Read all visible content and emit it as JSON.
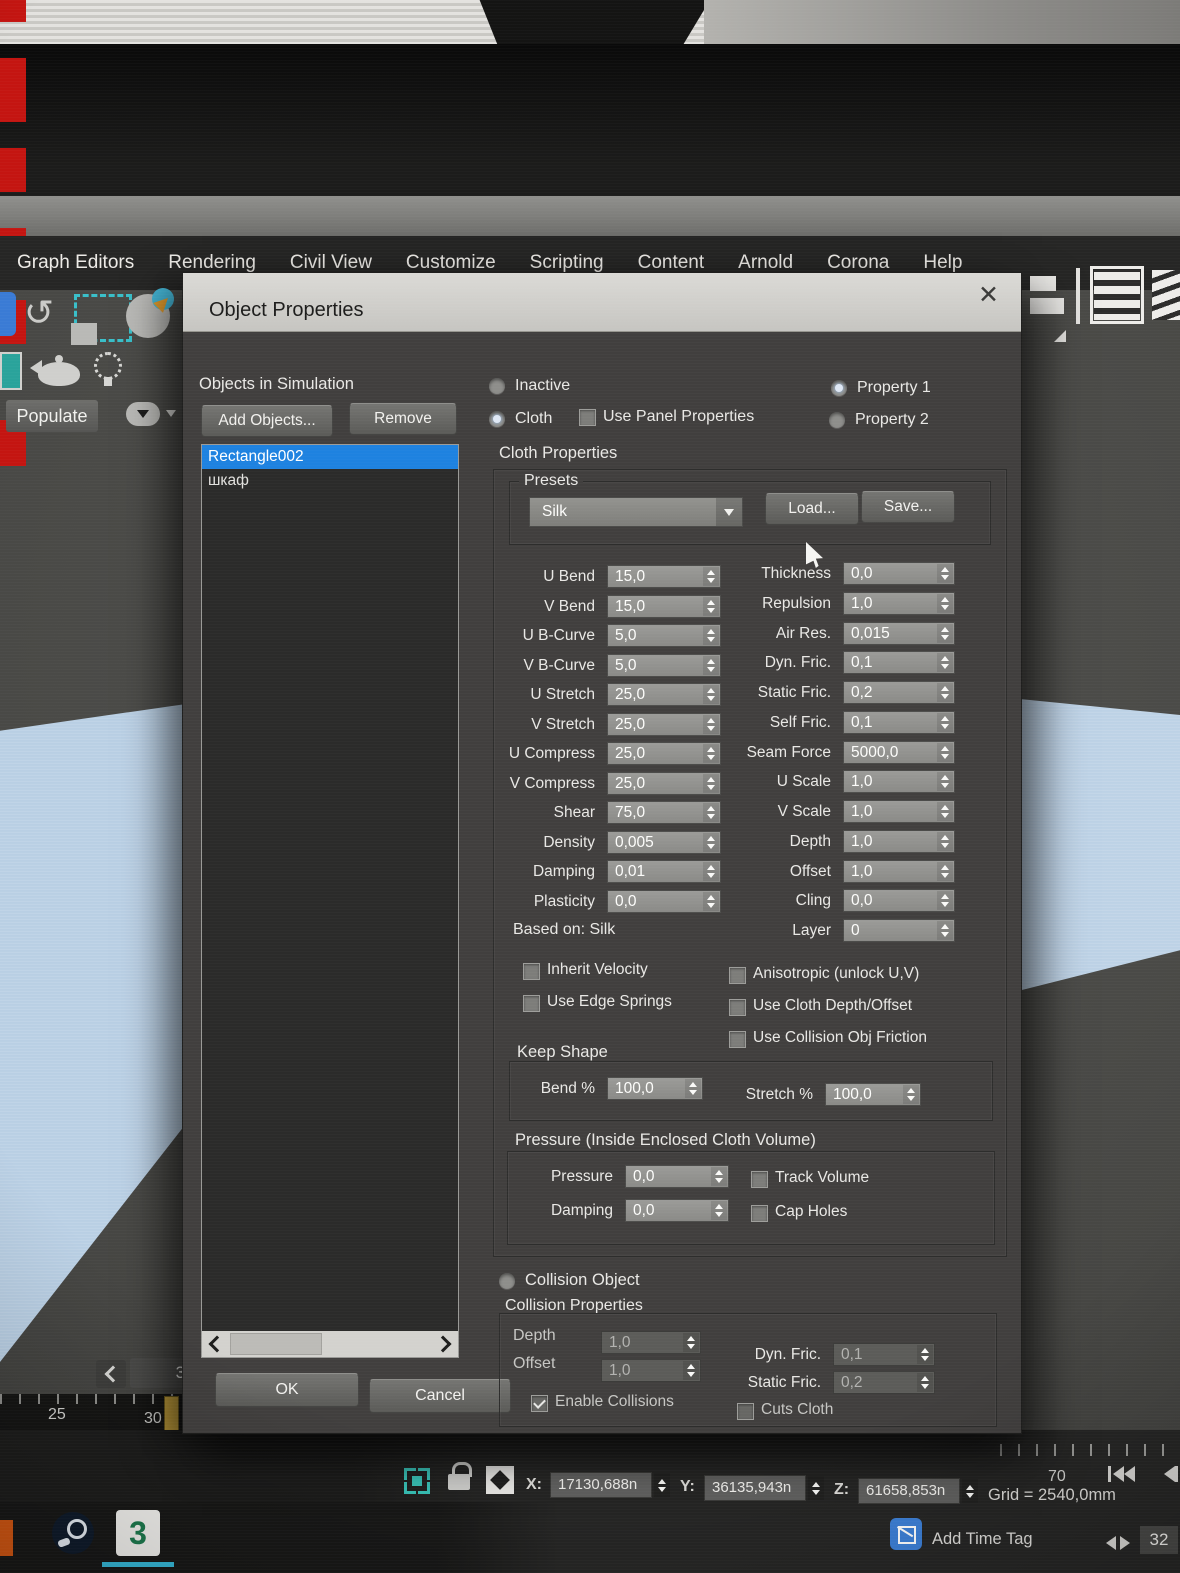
{
  "menu": {
    "items": [
      "Graph Editors",
      "Rendering",
      "Civil View",
      "Customize",
      "Scripting",
      "Content",
      "Arnold",
      "Corona",
      "Help"
    ]
  },
  "toolbar": {
    "populate_label": "Populate"
  },
  "dialog": {
    "title": "Object Properties",
    "close_glyph": "✕",
    "objects": {
      "heading": "Objects in Simulation",
      "add_button": "Add Objects...",
      "remove_button": "Remove",
      "items": [
        {
          "name": "Rectangle002",
          "selected": true
        },
        {
          "name": "шкаф",
          "selected": false
        }
      ]
    },
    "mode": {
      "inactive": "Inactive",
      "cloth": "Cloth",
      "use_panel": "Use Panel Properties",
      "property1": "Property 1",
      "property2": "Property 2"
    },
    "cloth": {
      "heading": "Cloth Properties",
      "presets_label": "Presets",
      "preset_value": "Silk",
      "load_button": "Load...",
      "save_button": "Save...",
      "params_left": [
        {
          "label": "U Bend",
          "value": "15,0"
        },
        {
          "label": "V Bend",
          "value": "15,0"
        },
        {
          "label": "U B-Curve",
          "value": "5,0"
        },
        {
          "label": "V B-Curve",
          "value": "5,0"
        },
        {
          "label": "U Stretch",
          "value": "25,0"
        },
        {
          "label": "V Stretch",
          "value": "25,0"
        },
        {
          "label": "U Compress",
          "value": "25,0"
        },
        {
          "label": "V Compress",
          "value": "25,0"
        },
        {
          "label": "Shear",
          "value": "75,0"
        },
        {
          "label": "Density",
          "value": "0,005"
        },
        {
          "label": "Damping",
          "value": "0,01"
        },
        {
          "label": "Plasticity",
          "value": "0,0"
        }
      ],
      "based_on": "Based on: Silk",
      "params_right": [
        {
          "label": "Thickness",
          "value": "0,0"
        },
        {
          "label": "Repulsion",
          "value": "1,0"
        },
        {
          "label": "Air Res.",
          "value": "0,015"
        },
        {
          "label": "Dyn. Fric.",
          "value": "0,1"
        },
        {
          "label": "Static Fric.",
          "value": "0,2"
        },
        {
          "label": "Self Fric.",
          "value": "0,1"
        },
        {
          "label": "Seam Force",
          "value": "5000,0"
        },
        {
          "label": "U Scale",
          "value": "1,0"
        },
        {
          "label": "V Scale",
          "value": "1,0"
        },
        {
          "label": "Depth",
          "value": "1,0"
        },
        {
          "label": "Offset",
          "value": "1,0"
        },
        {
          "label": "Cling",
          "value": "0,0"
        },
        {
          "label": "Layer",
          "value": "0"
        }
      ],
      "checks_left": [
        "Inherit Velocity",
        "Use Edge Springs"
      ],
      "checks_right": [
        "Anisotropic (unlock U,V)",
        "Use Cloth Depth/Offset",
        "Use Collision Obj Friction"
      ]
    },
    "keep_shape": {
      "heading": "Keep Shape",
      "bend_label": "Bend %",
      "bend_value": "100,0",
      "stretch_label": "Stretch %",
      "stretch_value": "100,0"
    },
    "pressure": {
      "heading": "Pressure (Inside Enclosed Cloth Volume)",
      "pressure_label": "Pressure",
      "pressure_value": "0,0",
      "damping_label": "Damping",
      "damping_value": "0,0",
      "track_volume": "Track Volume",
      "cap_holes": "Cap Holes"
    },
    "collision": {
      "radio_label": "Collision Object",
      "heading": "Collision Properties",
      "depth_label": "Depth",
      "depth_value": "1,0",
      "offset_label": "Offset",
      "offset_value": "1,0",
      "dyn_label": "Dyn. Fric.",
      "dyn_value": "0,1",
      "static_label": "Static Fric.",
      "static_value": "0,2",
      "enable": "Enable Collisions",
      "cuts": "Cuts Cloth"
    },
    "ok_button": "OK",
    "cancel_button": "Cancel"
  },
  "timeline": {
    "frame_display": "32 /",
    "tick_25": "25",
    "tick_30": "30",
    "right_tick": "70"
  },
  "status": {
    "x_label": "X:",
    "x_value": "17130,688n",
    "y_label": "Y:",
    "y_value": "36135,943n",
    "z_label": "Z:",
    "z_value": "61658,853n",
    "grid": "Grid = 2540,0mm",
    "add_time_tag": "Add Time Tag",
    "frame_field": "32"
  }
}
